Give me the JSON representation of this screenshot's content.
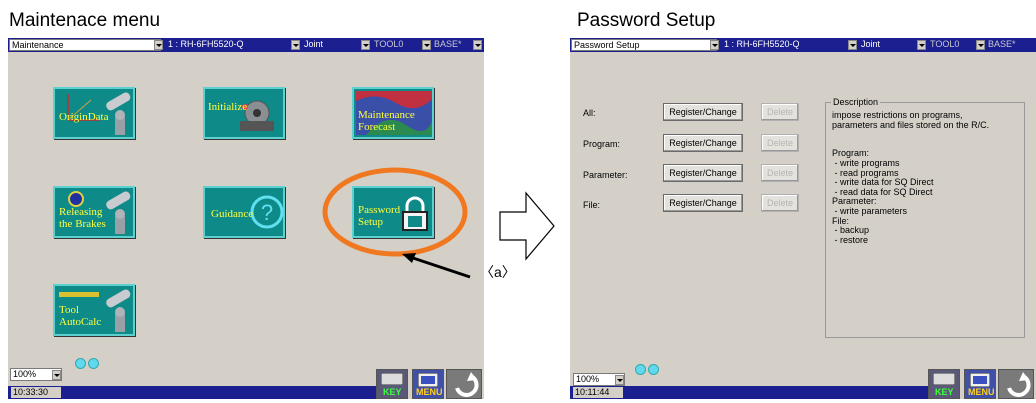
{
  "left": {
    "heading": "Maintenace menu",
    "menu_combo": "Maintenance",
    "robot_combo": "1 : RH-6FH5520-Q",
    "jog_combo": "Joint",
    "tool_combo": "TOOL0",
    "base_combo": "BASE*",
    "tiles": {
      "origin_data": "OriginData",
      "initialize": "Initialize",
      "maintenance_forecast": "Maintenance\nForecast",
      "releasing_brakes": "Releasing\nthe Brakes",
      "guidance": "Guidance",
      "password_setup": "Password\nSetup",
      "tool_autocalc": "Tool\nAutoCalc"
    },
    "zoom": "100%",
    "time": "10:33:30",
    "key_label": "KEY",
    "menu_label": "MENU"
  },
  "callout": "〈a〉",
  "right": {
    "heading": "Password Setup",
    "menu_combo": "Password Setup",
    "robot_combo": "1 : RH-6FH5520-Q",
    "jog_combo": "Joint",
    "tool_combo": "TOOL0",
    "base_combo": "BASE*",
    "rows": [
      {
        "label": "All:",
        "register": "Register/Change",
        "delete": "Delete"
      },
      {
        "label": "Program:",
        "register": "Register/Change",
        "delete": "Delete"
      },
      {
        "label": "Parameter:",
        "register": "Register/Change",
        "delete": "Delete"
      },
      {
        "label": "File:",
        "register": "Register/Change",
        "delete": "Delete"
      }
    ],
    "description_title": "Description",
    "description_text": "impose restrictions on programs,\nparameters and files stored on the R/C.\n\n\nProgram:\n - write programs\n - read programs\n - write data for SQ Direct\n - read data for SQ Direct\nParameter:\n - write parameters\nFile:\n - backup\n - restore",
    "zoom": "100%",
    "time": "10:11:44",
    "key_label": "KEY",
    "menu_label": "MENU"
  },
  "colors": {
    "panel": "#d4d0c8",
    "titlebar": "#1b1f8f",
    "tile": "#0e8a88",
    "tile_text": "#ffff40",
    "highlight": "#f07820"
  }
}
